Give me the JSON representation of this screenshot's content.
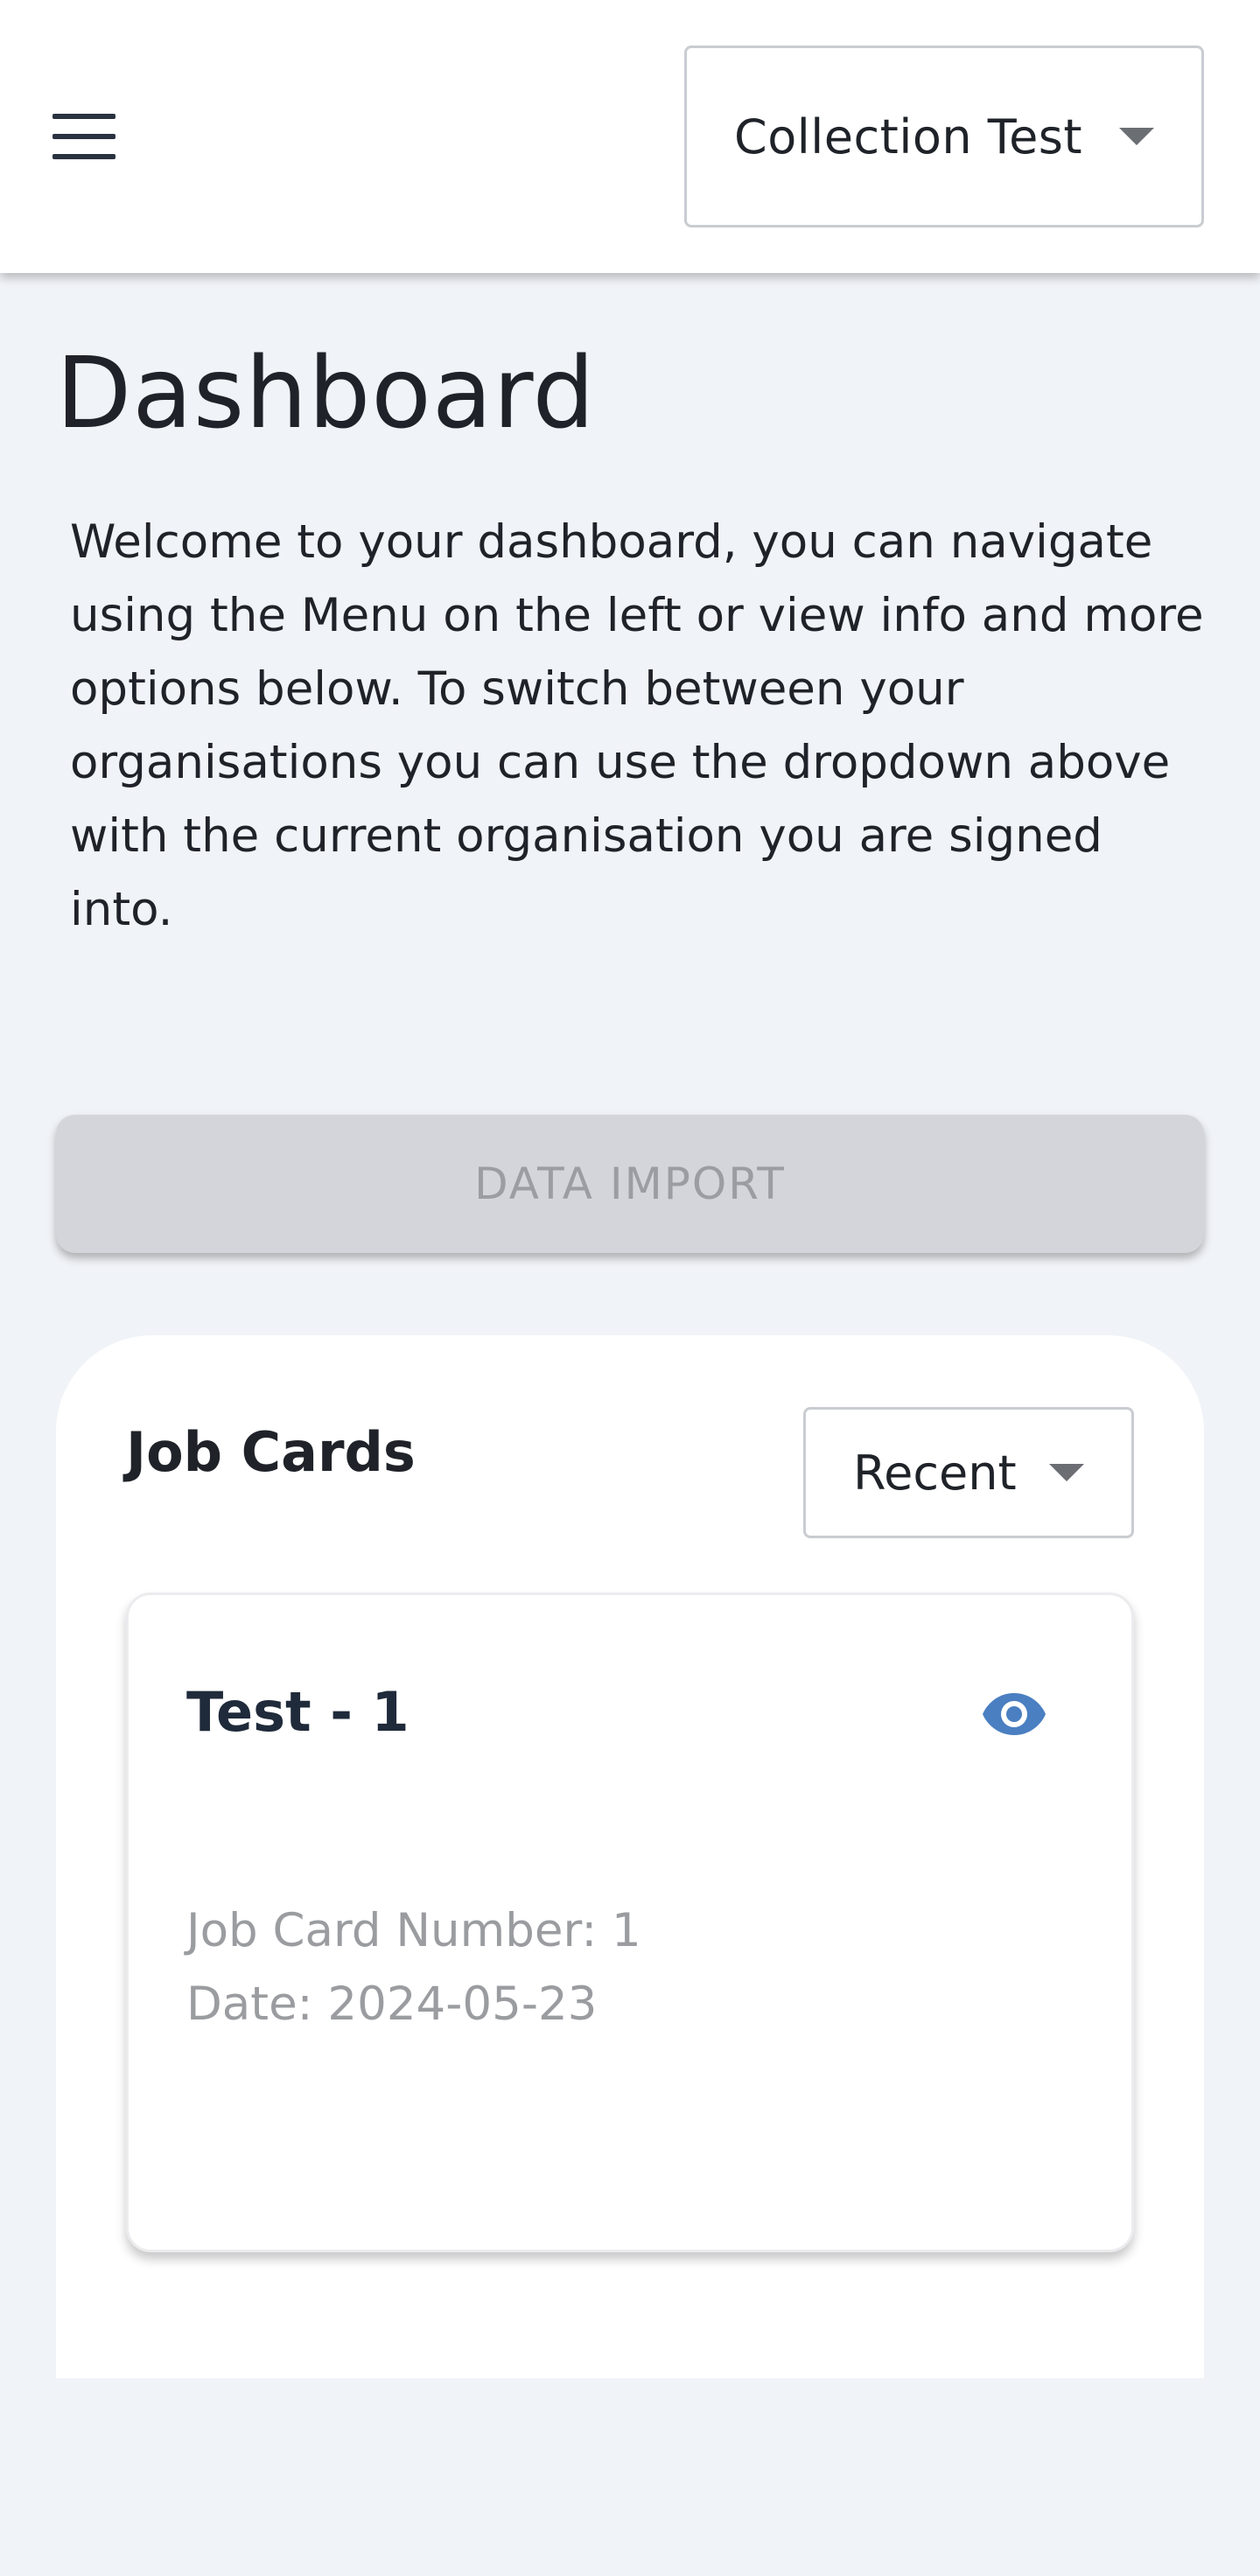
{
  "header": {
    "menu_icon": "hamburger-menu-icon",
    "org_selector": {
      "selected": "Collection Test",
      "caret_icon": "caret-down-icon"
    }
  },
  "page": {
    "title": "Dashboard",
    "welcome_text": "Welcome to your dashboard, you can navigate using the Menu on the left or view info and more options below. To switch between your organisations you can use the dropdown above with the current organisation you are signed into.",
    "data_import_label": "DATA IMPORT"
  },
  "job_cards": {
    "title": "Job Cards",
    "filter": {
      "selected": "Recent",
      "caret_icon": "caret-down-icon"
    },
    "items": [
      {
        "title": "Test - 1",
        "view_icon": "eye-icon",
        "number_line": "Job Card Number: 1",
        "date_line": "Date: 2024-05-23"
      }
    ]
  },
  "colors": {
    "background": "#f0f3f7",
    "accent_eye": "#4a7fc1",
    "disabled_button": "#d4d5da",
    "disabled_text": "#9b9da2"
  }
}
